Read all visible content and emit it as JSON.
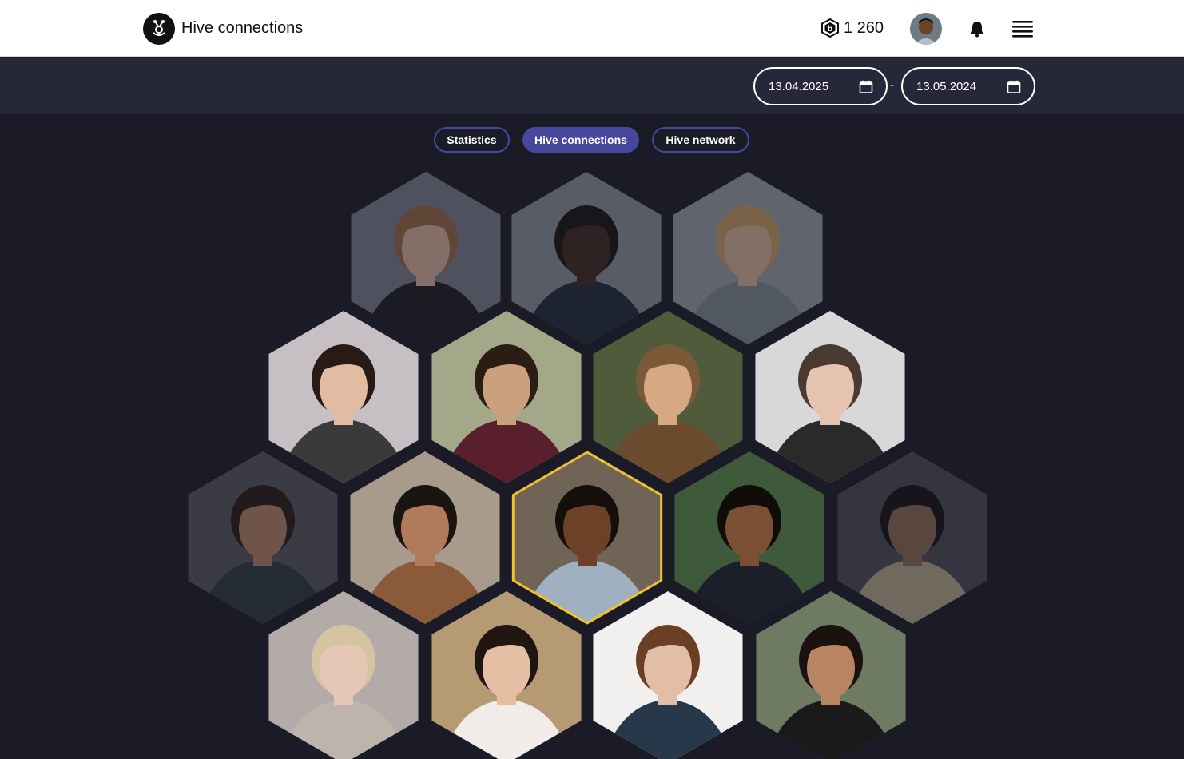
{
  "header": {
    "brand": "Hive connections",
    "logo_icon": "bee-logo-icon",
    "coins": "1 260",
    "coin_icon": "b-coin-icon",
    "avatar_alt": "user avatar",
    "notification_icon": "bell-icon",
    "menu_icon": "hamburger-menu-icon"
  },
  "dates": {
    "from": "13.04.2025",
    "to": "13.05.2024",
    "separator": "-",
    "calendar_icon": "calendar-icon"
  },
  "tabs": [
    {
      "label": "Statistics",
      "active": false
    },
    {
      "label": "Hive connections",
      "active": true
    },
    {
      "label": "Hive network",
      "active": false
    }
  ],
  "hive": {
    "highlight_color": "#f2c12e",
    "cells": [
      {
        "person": "woman-long-hair",
        "dimmed": true
      },
      {
        "person": "man-sunglasses",
        "dimmed": true
      },
      {
        "person": "young-man-smiling",
        "dimmed": true
      },
      {
        "person": "woman-bob-hair",
        "dimmed": false
      },
      {
        "person": "man-glasses-curly",
        "dimmed": false
      },
      {
        "person": "woman-hijab",
        "dimmed": false
      },
      {
        "person": "bald-bearded-man",
        "dimmed": false
      },
      {
        "person": "curly-man-smiling",
        "dimmed": true
      },
      {
        "person": "bearded-man-beanie",
        "dimmed": false
      },
      {
        "person": "smiling-young-man",
        "dimmed": false,
        "selected": true
      },
      {
        "person": "woman-tank-top",
        "dimmed": false
      },
      {
        "person": "man-street-jacket",
        "dimmed": true
      },
      {
        "person": "blonde-woman",
        "dimmed": false
      },
      {
        "person": "woman-hands-chin",
        "dimmed": false
      },
      {
        "person": "young-man-brown-hair",
        "dimmed": false
      },
      {
        "person": "woman-dark-hair",
        "dimmed": false
      }
    ]
  }
}
